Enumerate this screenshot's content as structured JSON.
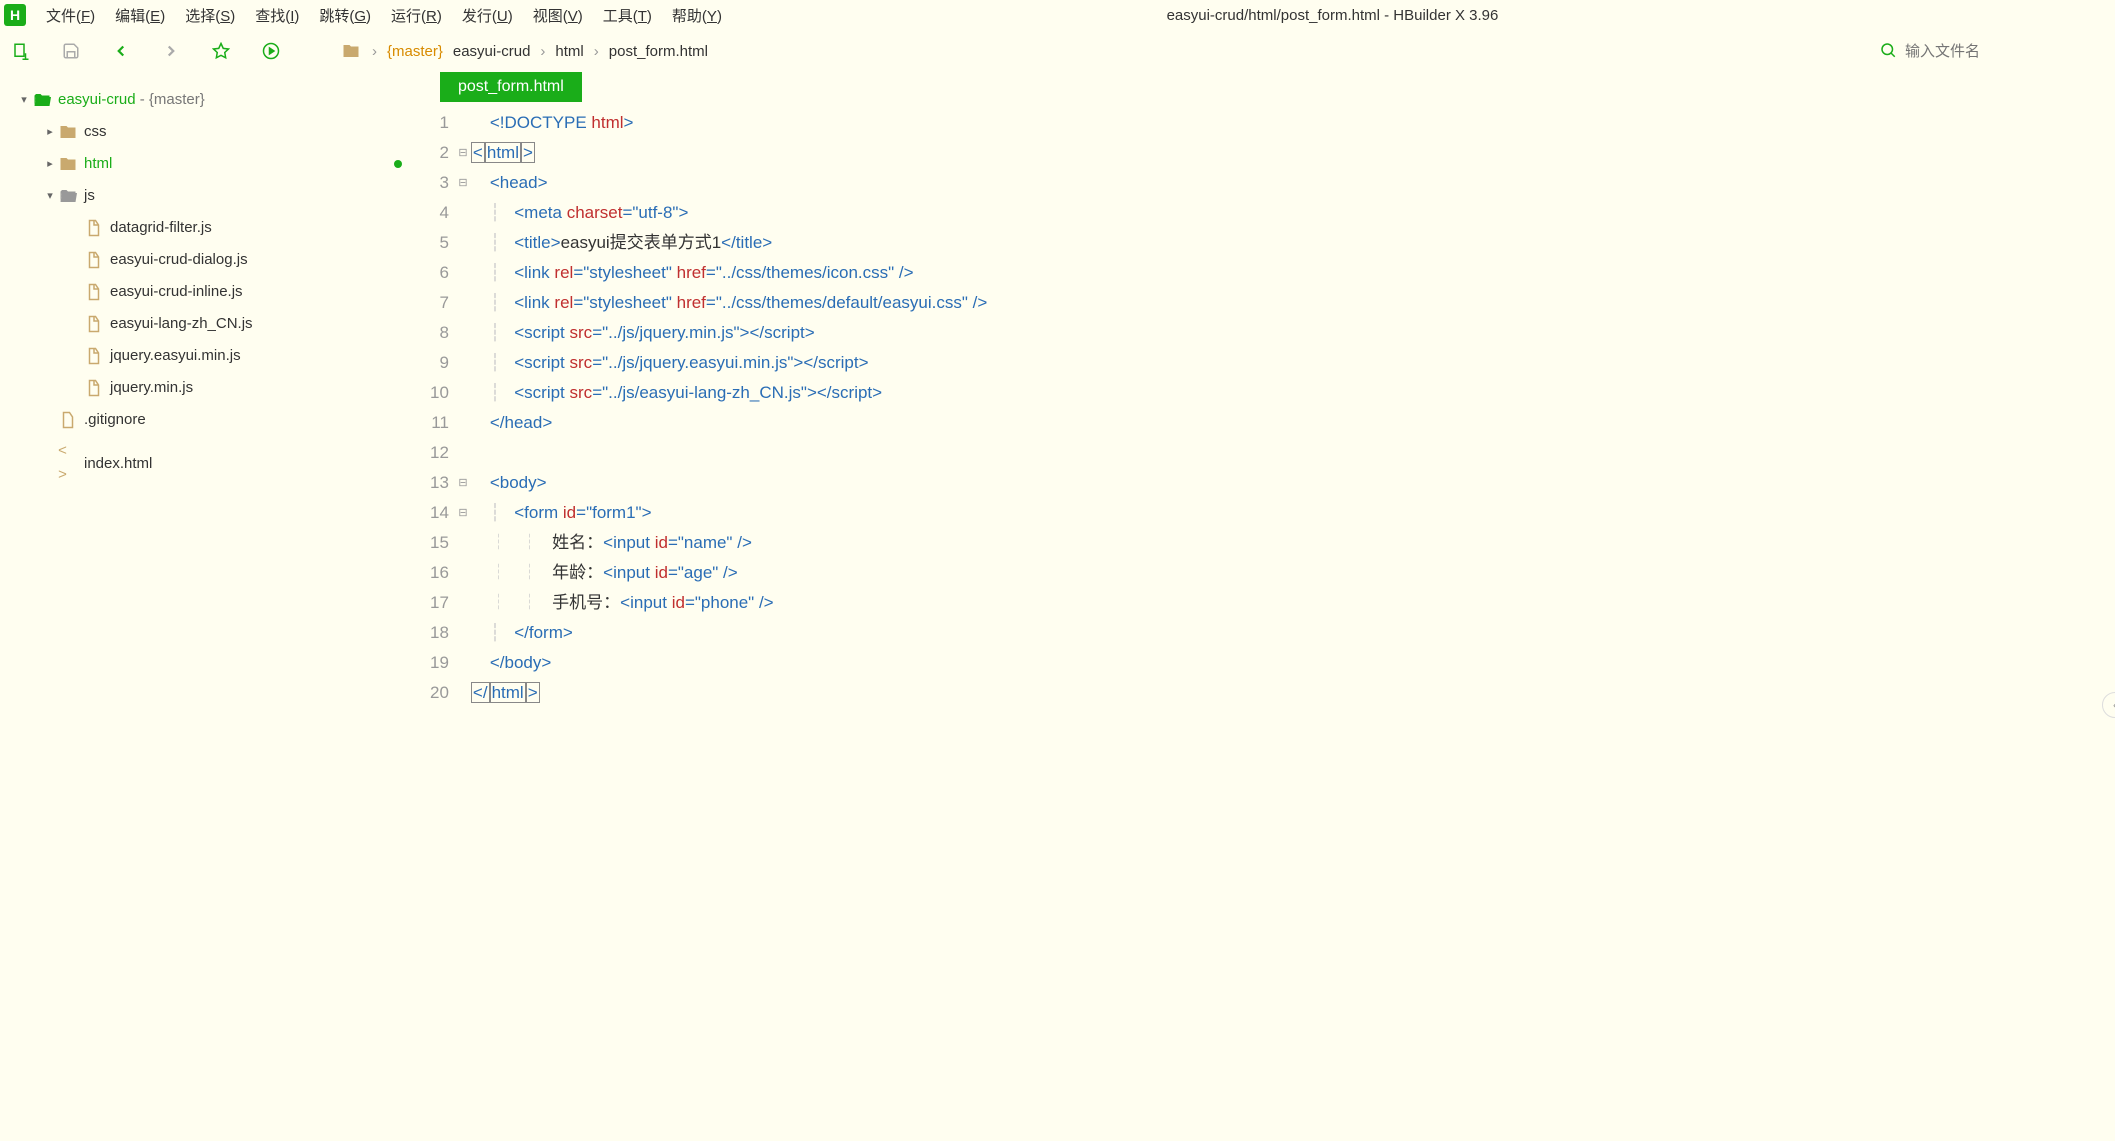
{
  "app": {
    "title": "easyui-crud/html/post_form.html - HBuilder X 3.96",
    "logo_letter": "H"
  },
  "menu": [
    {
      "label": "文件",
      "accel": "F"
    },
    {
      "label": "编辑",
      "accel": "E"
    },
    {
      "label": "选择",
      "accel": "S"
    },
    {
      "label": "查找",
      "accel": "I"
    },
    {
      "label": "跳转",
      "accel": "G"
    },
    {
      "label": "运行",
      "accel": "R"
    },
    {
      "label": "发行",
      "accel": "U"
    },
    {
      "label": "视图",
      "accel": "V"
    },
    {
      "label": "工具",
      "accel": "T"
    },
    {
      "label": "帮助",
      "accel": "Y"
    }
  ],
  "breadcrumb": {
    "branch": "{master}",
    "segs": [
      "easyui-crud",
      "html",
      "post_form.html"
    ]
  },
  "search": {
    "placeholder": "输入文件名"
  },
  "tree": [
    {
      "depth": 0,
      "caret": "▾",
      "icon": "folder-open",
      "style": "row-bold",
      "label": "easyui-crud",
      "suffix": " - {master}"
    },
    {
      "depth": 1,
      "caret": "▸",
      "icon": "folder-closed",
      "label": "css"
    },
    {
      "depth": 1,
      "caret": "▸",
      "icon": "folder-closed",
      "label": "html",
      "active": true,
      "modified": true
    },
    {
      "depth": 1,
      "caret": "▾",
      "icon": "folder-open-dim",
      "label": "js"
    },
    {
      "depth": 2,
      "caret": "",
      "icon": "file",
      "label": "datagrid-filter.js"
    },
    {
      "depth": 2,
      "caret": "",
      "icon": "file",
      "label": "easyui-crud-dialog.js"
    },
    {
      "depth": 2,
      "caret": "",
      "icon": "file",
      "label": "easyui-crud-inline.js"
    },
    {
      "depth": 2,
      "caret": "",
      "icon": "file",
      "label": "easyui-lang-zh_CN.js"
    },
    {
      "depth": 2,
      "caret": "",
      "icon": "file",
      "label": "jquery.easyui.min.js"
    },
    {
      "depth": 2,
      "caret": "",
      "icon": "file",
      "label": "jquery.min.js"
    },
    {
      "depth": 1,
      "caret": "",
      "icon": "file-doc",
      "label": ".gitignore"
    },
    {
      "depth": 1,
      "caret": "",
      "icon": "file-code",
      "label": "index.html"
    }
  ],
  "tab": {
    "name": "post_form.html"
  },
  "code": {
    "lines": [
      {
        "n": 1,
        "fold": "",
        "tokens": [
          {
            "c": "txt",
            "t": "    "
          },
          {
            "c": "punc",
            "t": "<!"
          },
          {
            "c": "tag",
            "t": "DOCTYPE"
          },
          {
            "c": "txt",
            "t": " "
          },
          {
            "c": "attr",
            "t": "html"
          },
          {
            "c": "punc",
            "t": ">"
          }
        ]
      },
      {
        "n": 2,
        "fold": "⊟",
        "tokens": [
          {
            "c": "punc boxed",
            "t": "<"
          },
          {
            "c": "tag boxed",
            "t": "html"
          },
          {
            "c": "punc boxed",
            "t": ">"
          }
        ]
      },
      {
        "n": 3,
        "fold": "⊟",
        "tokens": [
          {
            "c": "txt",
            "t": "    "
          },
          {
            "c": "punc",
            "t": "<"
          },
          {
            "c": "tag",
            "t": "head"
          },
          {
            "c": "punc",
            "t": ">"
          }
        ]
      },
      {
        "n": 4,
        "fold": "",
        "tokens": [
          {
            "c": "guide",
            "t": "    ┆   "
          },
          {
            "c": "punc",
            "t": "<"
          },
          {
            "c": "tag",
            "t": "meta"
          },
          {
            "c": "txt",
            "t": " "
          },
          {
            "c": "attr",
            "t": "charset"
          },
          {
            "c": "punc",
            "t": "="
          },
          {
            "c": "str",
            "t": "\"utf-8\""
          },
          {
            "c": "punc",
            "t": ">"
          }
        ]
      },
      {
        "n": 5,
        "fold": "",
        "tokens": [
          {
            "c": "guide",
            "t": "    ┆   "
          },
          {
            "c": "punc",
            "t": "<"
          },
          {
            "c": "tag",
            "t": "title"
          },
          {
            "c": "punc",
            "t": ">"
          },
          {
            "c": "txt",
            "t": "easyui提交表单方式1"
          },
          {
            "c": "punc",
            "t": "</"
          },
          {
            "c": "tag",
            "t": "title"
          },
          {
            "c": "punc",
            "t": ">"
          }
        ]
      },
      {
        "n": 6,
        "fold": "",
        "tokens": [
          {
            "c": "guide",
            "t": "    ┆   "
          },
          {
            "c": "punc",
            "t": "<"
          },
          {
            "c": "tag",
            "t": "link"
          },
          {
            "c": "txt",
            "t": " "
          },
          {
            "c": "attr",
            "t": "rel"
          },
          {
            "c": "punc",
            "t": "="
          },
          {
            "c": "str",
            "t": "\"stylesheet\""
          },
          {
            "c": "txt",
            "t": " "
          },
          {
            "c": "attr",
            "t": "href"
          },
          {
            "c": "punc",
            "t": "="
          },
          {
            "c": "str",
            "t": "\"../css/themes/icon.css\""
          },
          {
            "c": "txt",
            "t": " "
          },
          {
            "c": "punc",
            "t": "/>"
          }
        ]
      },
      {
        "n": 7,
        "fold": "",
        "tokens": [
          {
            "c": "guide",
            "t": "    ┆   "
          },
          {
            "c": "punc",
            "t": "<"
          },
          {
            "c": "tag",
            "t": "link"
          },
          {
            "c": "txt",
            "t": " "
          },
          {
            "c": "attr",
            "t": "rel"
          },
          {
            "c": "punc",
            "t": "="
          },
          {
            "c": "str",
            "t": "\"stylesheet\""
          },
          {
            "c": "txt",
            "t": " "
          },
          {
            "c": "attr",
            "t": "href"
          },
          {
            "c": "punc",
            "t": "="
          },
          {
            "c": "str",
            "t": "\"../css/themes/default/easyui.css\""
          },
          {
            "c": "txt",
            "t": " "
          },
          {
            "c": "punc",
            "t": "/>"
          }
        ]
      },
      {
        "n": 8,
        "fold": "",
        "tokens": [
          {
            "c": "guide",
            "t": "    ┆   "
          },
          {
            "c": "punc",
            "t": "<"
          },
          {
            "c": "tag",
            "t": "script"
          },
          {
            "c": "txt",
            "t": " "
          },
          {
            "c": "attr",
            "t": "src"
          },
          {
            "c": "punc",
            "t": "="
          },
          {
            "c": "str",
            "t": "\"../js/jquery.min.js\""
          },
          {
            "c": "punc",
            "t": "></"
          },
          {
            "c": "tag",
            "t": "script"
          },
          {
            "c": "punc",
            "t": ">"
          }
        ]
      },
      {
        "n": 9,
        "fold": "",
        "tokens": [
          {
            "c": "guide",
            "t": "    ┆   "
          },
          {
            "c": "punc",
            "t": "<"
          },
          {
            "c": "tag",
            "t": "script"
          },
          {
            "c": "txt",
            "t": " "
          },
          {
            "c": "attr",
            "t": "src"
          },
          {
            "c": "punc",
            "t": "="
          },
          {
            "c": "str",
            "t": "\"../js/jquery.easyui.min.js\""
          },
          {
            "c": "punc",
            "t": "></"
          },
          {
            "c": "tag",
            "t": "script"
          },
          {
            "c": "punc",
            "t": ">"
          }
        ]
      },
      {
        "n": 10,
        "fold": "",
        "tokens": [
          {
            "c": "guide",
            "t": "    ┆   "
          },
          {
            "c": "punc",
            "t": "<"
          },
          {
            "c": "tag",
            "t": "script"
          },
          {
            "c": "txt",
            "t": " "
          },
          {
            "c": "attr",
            "t": "src"
          },
          {
            "c": "punc",
            "t": "="
          },
          {
            "c": "str",
            "t": "\"../js/easyui-lang-zh_CN.js\""
          },
          {
            "c": "punc",
            "t": "></"
          },
          {
            "c": "tag",
            "t": "script"
          },
          {
            "c": "punc",
            "t": ">"
          }
        ]
      },
      {
        "n": 11,
        "fold": "",
        "tokens": [
          {
            "c": "txt",
            "t": "    "
          },
          {
            "c": "punc",
            "t": "</"
          },
          {
            "c": "tag",
            "t": "head"
          },
          {
            "c": "punc",
            "t": ">"
          }
        ]
      },
      {
        "n": 12,
        "fold": "",
        "tokens": []
      },
      {
        "n": 13,
        "fold": "⊟",
        "tokens": [
          {
            "c": "txt",
            "t": "    "
          },
          {
            "c": "punc",
            "t": "<"
          },
          {
            "c": "tag",
            "t": "body"
          },
          {
            "c": "punc",
            "t": ">"
          }
        ]
      },
      {
        "n": 14,
        "fold": "⊟",
        "tokens": [
          {
            "c": "guide",
            "t": "    ┆   "
          },
          {
            "c": "punc",
            "t": "<"
          },
          {
            "c": "tag",
            "t": "form"
          },
          {
            "c": "txt",
            "t": " "
          },
          {
            "c": "attr",
            "t": "id"
          },
          {
            "c": "punc",
            "t": "="
          },
          {
            "c": "str",
            "t": "\"form1\""
          },
          {
            "c": "punc",
            "t": ">"
          }
        ]
      },
      {
        "n": 15,
        "fold": "",
        "tokens": [
          {
            "c": "guide",
            "t": "    ┆   ┆   "
          },
          {
            "c": "txt",
            "t": "姓名："
          },
          {
            "c": "punc",
            "t": "<"
          },
          {
            "c": "tag",
            "t": "input"
          },
          {
            "c": "txt",
            "t": " "
          },
          {
            "c": "attr",
            "t": "id"
          },
          {
            "c": "punc",
            "t": "="
          },
          {
            "c": "str",
            "t": "\"name\""
          },
          {
            "c": "txt",
            "t": " "
          },
          {
            "c": "punc",
            "t": "/>"
          }
        ]
      },
      {
        "n": 16,
        "fold": "",
        "tokens": [
          {
            "c": "guide",
            "t": "    ┆   ┆   "
          },
          {
            "c": "txt",
            "t": "年龄："
          },
          {
            "c": "punc",
            "t": "<"
          },
          {
            "c": "tag",
            "t": "input"
          },
          {
            "c": "txt",
            "t": " "
          },
          {
            "c": "attr",
            "t": "id"
          },
          {
            "c": "punc",
            "t": "="
          },
          {
            "c": "str",
            "t": "\"age\""
          },
          {
            "c": "txt",
            "t": " "
          },
          {
            "c": "punc",
            "t": "/>"
          }
        ]
      },
      {
        "n": 17,
        "fold": "",
        "tokens": [
          {
            "c": "guide",
            "t": "    ┆   ┆   "
          },
          {
            "c": "txt",
            "t": "手机号："
          },
          {
            "c": "punc",
            "t": "<"
          },
          {
            "c": "tag",
            "t": "input"
          },
          {
            "c": "txt",
            "t": " "
          },
          {
            "c": "attr",
            "t": "id"
          },
          {
            "c": "punc",
            "t": "="
          },
          {
            "c": "str",
            "t": "\"phone\""
          },
          {
            "c": "txt",
            "t": " "
          },
          {
            "c": "punc",
            "t": "/>"
          }
        ]
      },
      {
        "n": 18,
        "fold": "",
        "tokens": [
          {
            "c": "guide",
            "t": "    ┆   "
          },
          {
            "c": "punc",
            "t": "</"
          },
          {
            "c": "tag",
            "t": "form"
          },
          {
            "c": "punc",
            "t": ">"
          }
        ]
      },
      {
        "n": 19,
        "fold": "",
        "tokens": [
          {
            "c": "txt",
            "t": "    "
          },
          {
            "c": "punc",
            "t": "</"
          },
          {
            "c": "tag",
            "t": "body"
          },
          {
            "c": "punc",
            "t": ">"
          }
        ]
      },
      {
        "n": 20,
        "fold": "",
        "tokens": [
          {
            "c": "punc boxed",
            "t": "</"
          },
          {
            "c": "tag boxed",
            "t": "html"
          },
          {
            "c": "punc boxed",
            "t": ">"
          }
        ]
      }
    ]
  }
}
